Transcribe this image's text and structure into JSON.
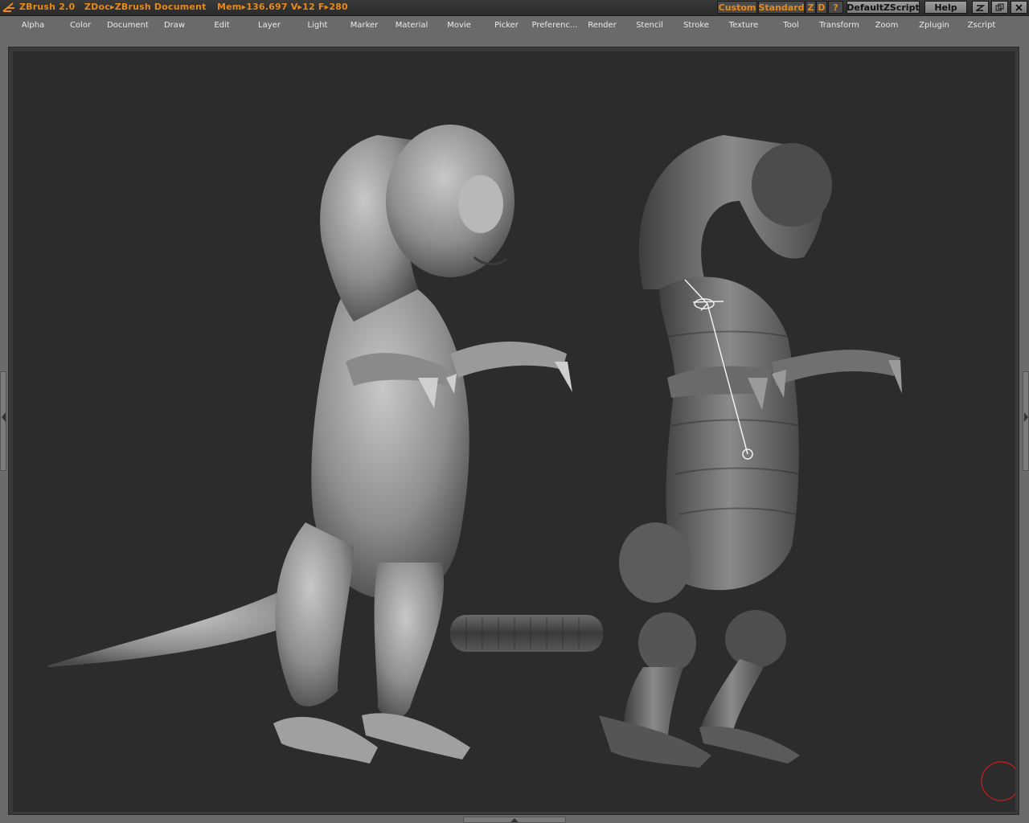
{
  "app": {
    "title": "ZBrush 2.0",
    "doc_label": "ZDoc▸ZBrush Document",
    "stats": "Mem▸136.697  V▸12  F▸280"
  },
  "titlebar_buttons": {
    "custom": "Custom",
    "standard": "Standard",
    "z": "Z",
    "d": "D",
    "question": "?",
    "default_zscript": "DefaultZScript",
    "help": "Help"
  },
  "menu": [
    "Alpha",
    "Color",
    "Document",
    "Draw",
    "Edit",
    "Layer",
    "Light",
    "Marker",
    "Material",
    "Movie",
    "Picker",
    "Preferenc...",
    "Render",
    "Stencil",
    "Stroke",
    "Texture",
    "Tool",
    "Transform",
    "Zoom",
    "Zplugin",
    "Zscript"
  ],
  "colors": {
    "accent": "#e88a1a",
    "canvas_bg": "#2c2c2c",
    "ui_gray": "#6a6a6a",
    "brush_cursor": "#b02020"
  },
  "icons": {
    "logo": "zbrush-logo-icon",
    "minimize": "minimize-icon",
    "restore": "restore-icon",
    "close": "close-icon",
    "left_arrow": "left-arrow-icon",
    "right_arrow": "right-arrow-icon",
    "up_arrow": "up-arrow-icon"
  }
}
